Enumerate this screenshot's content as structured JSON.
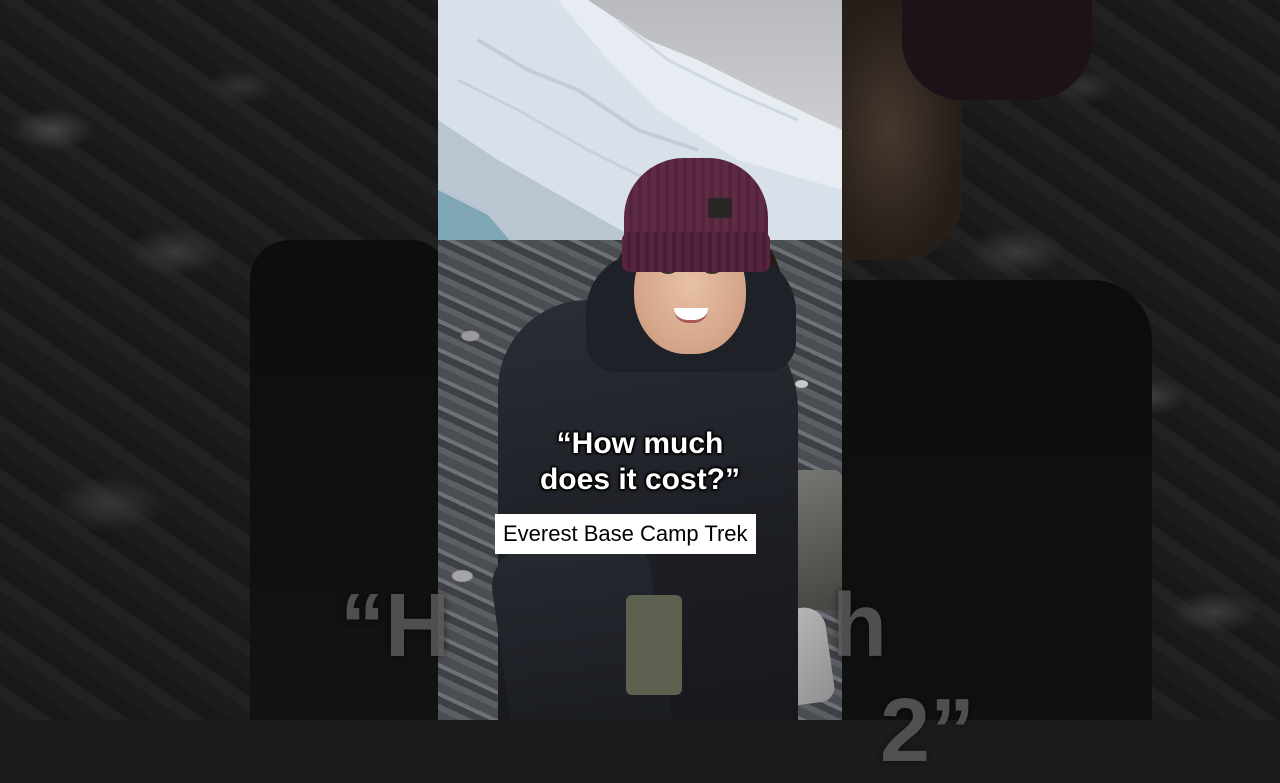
{
  "caption": {
    "quote_line1": "“How much",
    "quote_line2": "does it cost?”",
    "title_label": "Everest Base Camp Trek"
  },
  "ghost_text": {
    "left_top": "“H",
    "right_top": "h",
    "right_bottom": "2”"
  },
  "colors": {
    "beanie": "#5e2a44",
    "jacket": "#1f2128",
    "label_bg": "#ffffff",
    "caption_text": "#ffffff"
  }
}
